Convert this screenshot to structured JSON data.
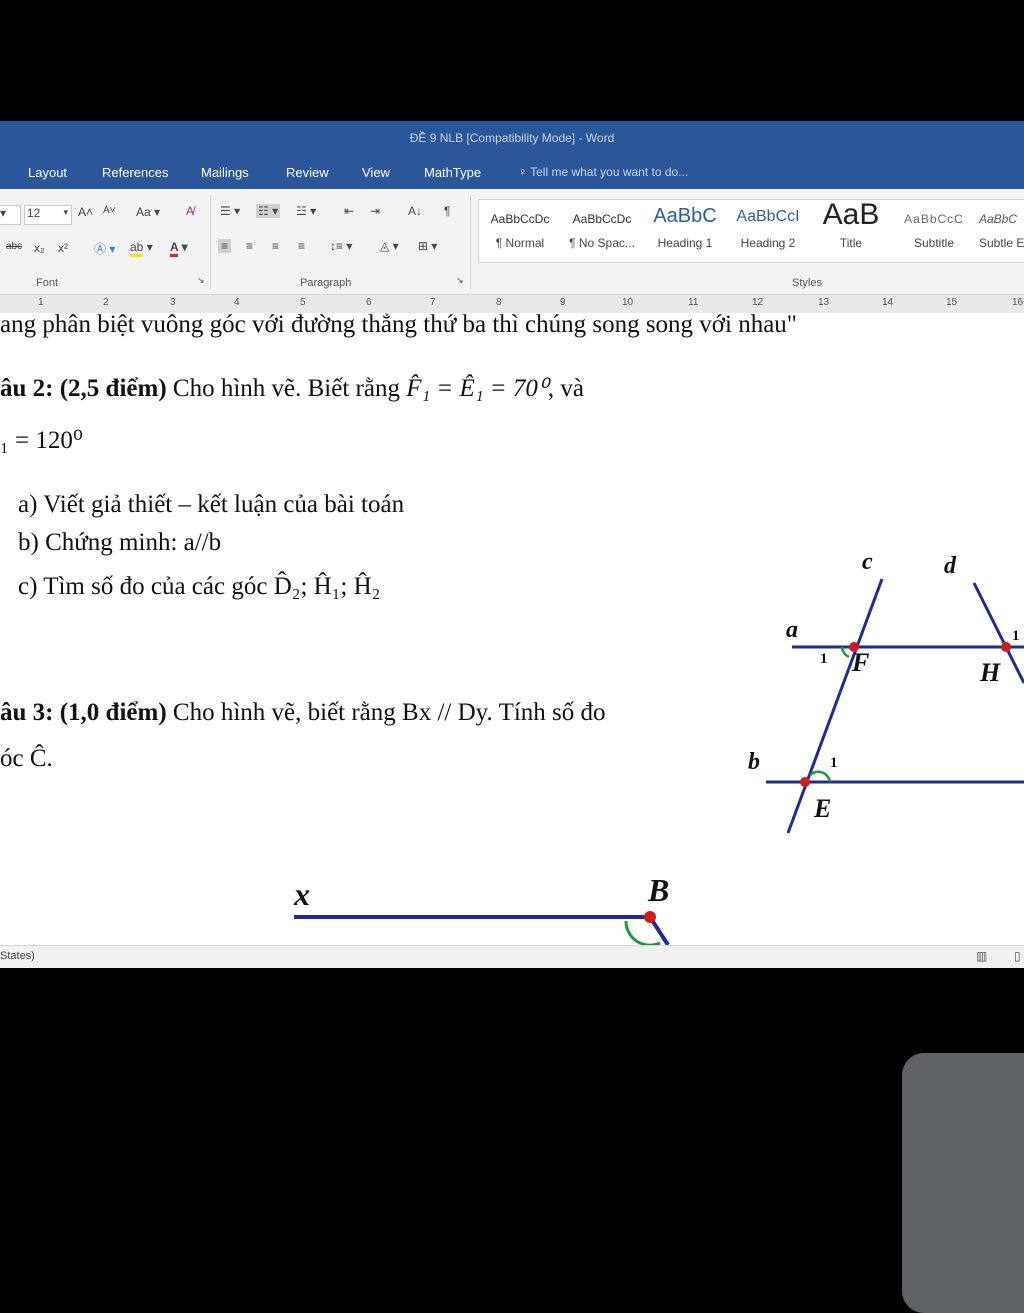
{
  "window": {
    "title": "ĐỀ 9 NLB [Compatibility Mode] - Word"
  },
  "tabs": [
    "Layout",
    "References",
    "Mailings",
    "Review",
    "View",
    "MathType"
  ],
  "tell_me": "Tell me what you want to do...",
  "ribbon": {
    "font_size": "12",
    "font_group_label": "Font",
    "paragraph_group_label": "Paragraph",
    "styles_group_label": "Styles",
    "change_case_label": "Aa",
    "styles": [
      {
        "sample": "AaBbCcDc",
        "name": "¶ Normal"
      },
      {
        "sample": "AaBbCcDc",
        "name": "¶ No Spac..."
      },
      {
        "sample": "AaBbC",
        "name": "Heading 1"
      },
      {
        "sample": "AaBbCcI",
        "name": "Heading 2"
      },
      {
        "sample": "AaB",
        "name": "Title"
      },
      {
        "sample": "AaBbCcC",
        "name": "Subtitle"
      },
      {
        "sample": "AaBbC",
        "name": "Subtle E"
      }
    ]
  },
  "ruler_marks": [
    "1",
    "2",
    "3",
    "4",
    "5",
    "6",
    "7",
    "8",
    "9",
    "10",
    "11",
    "12",
    "13",
    "14",
    "15",
    "16"
  ],
  "document": {
    "line0": "ang phân biệt vuông góc với đường thẳng thứ ba thì chúng song song với nhau\"",
    "q2_prefix": "âu 2: (2,5 điểm)",
    "q2_text": " Cho hình vẽ. Biết rằng ",
    "q2_eq": "F̂₁ = Ê₁ = 70⁰",
    "q2_suffix": ", và",
    "q2_line2": "₁ = 120⁰",
    "item_a": "a)   Viết giả thiết – kết luận của bài toán",
    "item_b": "b)   Chứng minh: a//b",
    "item_c": "c)   Tìm số đo của các góc D̂₂; Ĥ₁; Ĥ₂",
    "q3_prefix": "âu 3: (1,0 điểm)",
    "q3_text": " Cho hình vẽ, biết rằng Bx // Dy. Tính số đo",
    "q3_line2": "óc Ĉ.",
    "figure1": {
      "labels": {
        "c": "c",
        "d": "d",
        "a": "a",
        "b": "b",
        "F": "F",
        "H": "H",
        "E": "E",
        "one_F": "1",
        "one_E": "1",
        "one_H": "1"
      }
    },
    "figure2": {
      "labels": {
        "x": "x",
        "B": "B"
      }
    }
  },
  "status": {
    "text": "States)"
  },
  "colors": {
    "ribbon_blue": "#2b579a",
    "line_blue": "#1f2c8f",
    "point_red": "#d11a1a",
    "arc_green": "#1a9a3a"
  }
}
